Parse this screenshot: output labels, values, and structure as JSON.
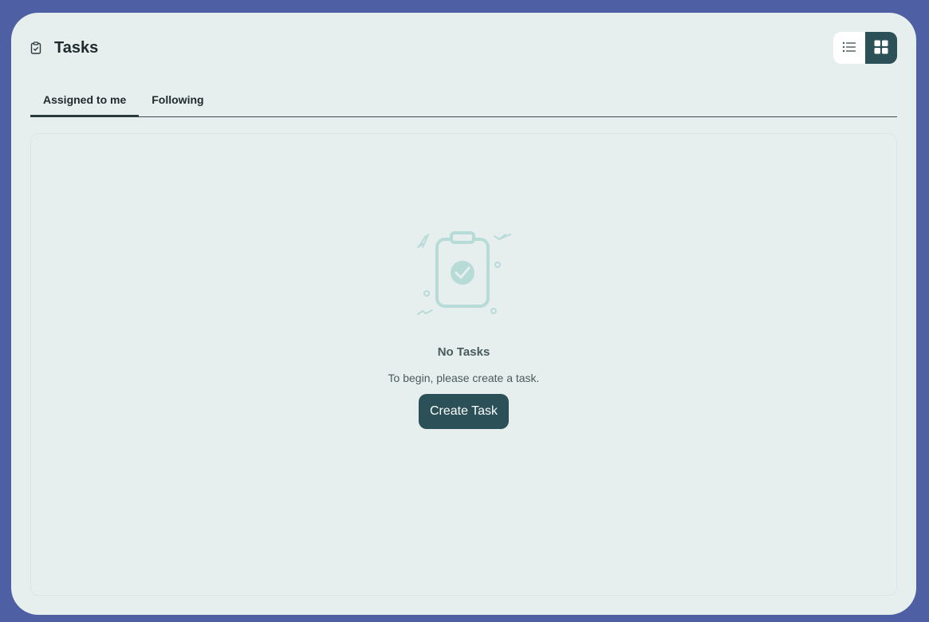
{
  "header": {
    "title": "Tasks",
    "title_icon": "clipboard-check-icon",
    "view_toggle": {
      "list_icon": "list-view-icon",
      "grid_icon": "grid-view-icon",
      "selected": "grid"
    }
  },
  "tabs": [
    {
      "label": "Assigned to me",
      "active": true
    },
    {
      "label": "Following",
      "active": false
    }
  ],
  "empty_state": {
    "illustration": "clipboard-check-illustration",
    "title": "No Tasks",
    "description": "To begin, please create a task.",
    "button_label": "Create Task"
  },
  "colors": {
    "background": "#4f5fa3",
    "card": "#e6efee",
    "accent": "#2b5057",
    "illustration": "#b7dcd8"
  }
}
